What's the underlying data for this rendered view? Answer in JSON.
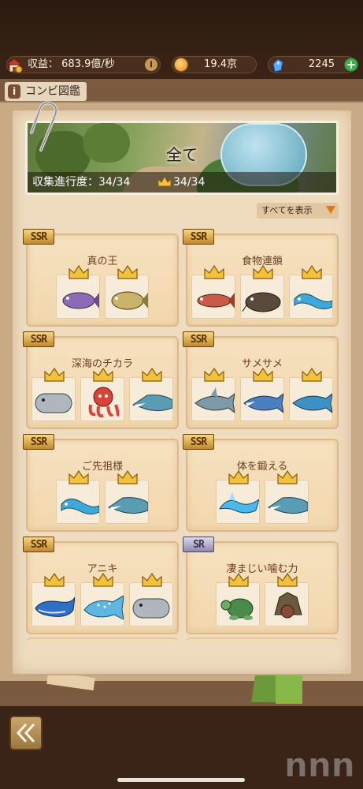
{
  "header": {
    "income_label": "収益：",
    "income_value": "683.9億/秒",
    "gold_value": "19.4京",
    "gem_value": "2245",
    "info_symbol": "i",
    "plus_symbol": "+"
  },
  "book": {
    "tab_icon": "i",
    "tab_label": "コンビ図鑑"
  },
  "banner": {
    "title": "全て",
    "progress_label": "収集進行度：",
    "progress_value": "34/34",
    "crown_value": "34/34"
  },
  "filter": {
    "label": "すべてを表示"
  },
  "combos": [
    {
      "rarity": "SSR",
      "title": "真の王",
      "slots": [
        "purple-fish",
        "bass-fish"
      ]
    },
    {
      "rarity": "SSR",
      "title": "食物連鎖",
      "slots": [
        "red-fish",
        "catfish",
        "blue-eel"
      ]
    },
    {
      "rarity": "SSR",
      "title": "深海のチカラ",
      "slots": [
        "sperm-whale",
        "red-octopus",
        "mosasaur"
      ]
    },
    {
      "rarity": "SSR",
      "title": "サメサメ",
      "slots": [
        "shark",
        "mako-shark",
        "blue-shark"
      ]
    },
    {
      "rarity": "SSR",
      "title": "ご先祖様",
      "slots": [
        "blue-eel",
        "mosasaur"
      ]
    },
    {
      "rarity": "SSR",
      "title": "体を鍛える",
      "slots": [
        "water-dragon",
        "mosasaur"
      ]
    },
    {
      "rarity": "SSR",
      "title": "アニキ",
      "slots": [
        "blue-whale",
        "whale-shark",
        "sperm-whale"
      ]
    },
    {
      "rarity": "SR",
      "title": "凄まじい噛む力",
      "slots": [
        "sea-turtle",
        "snapping-turtle"
      ]
    }
  ],
  "colors": {
    "card_bg": "#f3dab2",
    "title_brown": "#6a3d22",
    "accent_orange": "#e0761c",
    "plus_green": "#3fae4a"
  },
  "icons": {
    "back": "double-chevron-left-icon",
    "crown": "crown-icon",
    "gem": "gem-icon",
    "coin": "coin-icon",
    "house": "house-icon"
  }
}
